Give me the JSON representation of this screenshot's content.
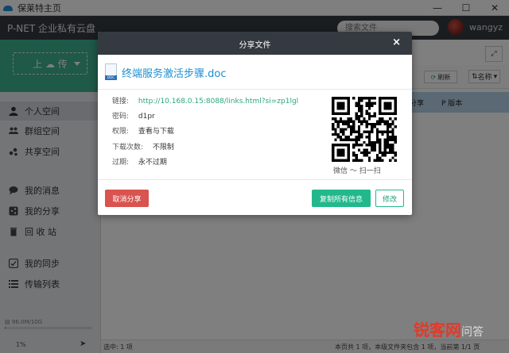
{
  "window": {
    "title": "保莱特主页",
    "minimize": "—",
    "maximize": "☐",
    "close": "✕"
  },
  "header": {
    "brand": "P-NET 企业私有云盘",
    "search_placeholder": "搜索文件",
    "username": "wangyz"
  },
  "sidebar": {
    "upload_label": "上 ☁ 传",
    "items": [
      {
        "label": "个人空间",
        "icon": "user-icon"
      },
      {
        "label": "群组空间",
        "icon": "group-icon"
      },
      {
        "label": "共享空间",
        "icon": "share-network-icon"
      },
      {
        "label": "我的消息",
        "icon": "chat-icon"
      },
      {
        "label": "我的分享",
        "icon": "share-icon"
      },
      {
        "label": "回 收 站",
        "icon": "trash-icon"
      },
      {
        "label": "我的同步",
        "icon": "sync-icon"
      },
      {
        "label": "传输列表",
        "icon": "list-icon"
      }
    ],
    "storage": "96.0M/10G",
    "percent": "1%",
    "usage_fraction": 0.01
  },
  "main": {
    "refresh_label": "刷新",
    "sort_label": "名称",
    "share_action": "分享",
    "version_action": "版本",
    "status_left": "选中: 1 项",
    "status_right": "本页共 1 项，本级文件夹包含 1 项，当前第 1/1 页"
  },
  "modal": {
    "title": "分享文件",
    "close": "×",
    "file_name": "终端服务激活步骤.doc",
    "doc_badge": "DOC",
    "link_label": "链接:",
    "link_value": "http://10.168.0.15:8088/links.html?si=zp1lgl",
    "password_label": "密码:",
    "password_value": "d1pr",
    "permission_label": "权限:",
    "permission_value": "查看与下载",
    "downloads_label": "下载次数:",
    "downloads_value": "不限制",
    "expire_label": "过期:",
    "expire_value": "永不过期",
    "qr_caption": "微信 ～ 扫一扫",
    "cancel_button": "取消分享",
    "copy_button": "复制所有信息",
    "edit_button": "修改"
  },
  "watermark": {
    "main": "锐客网",
    "sub": "问答"
  }
}
